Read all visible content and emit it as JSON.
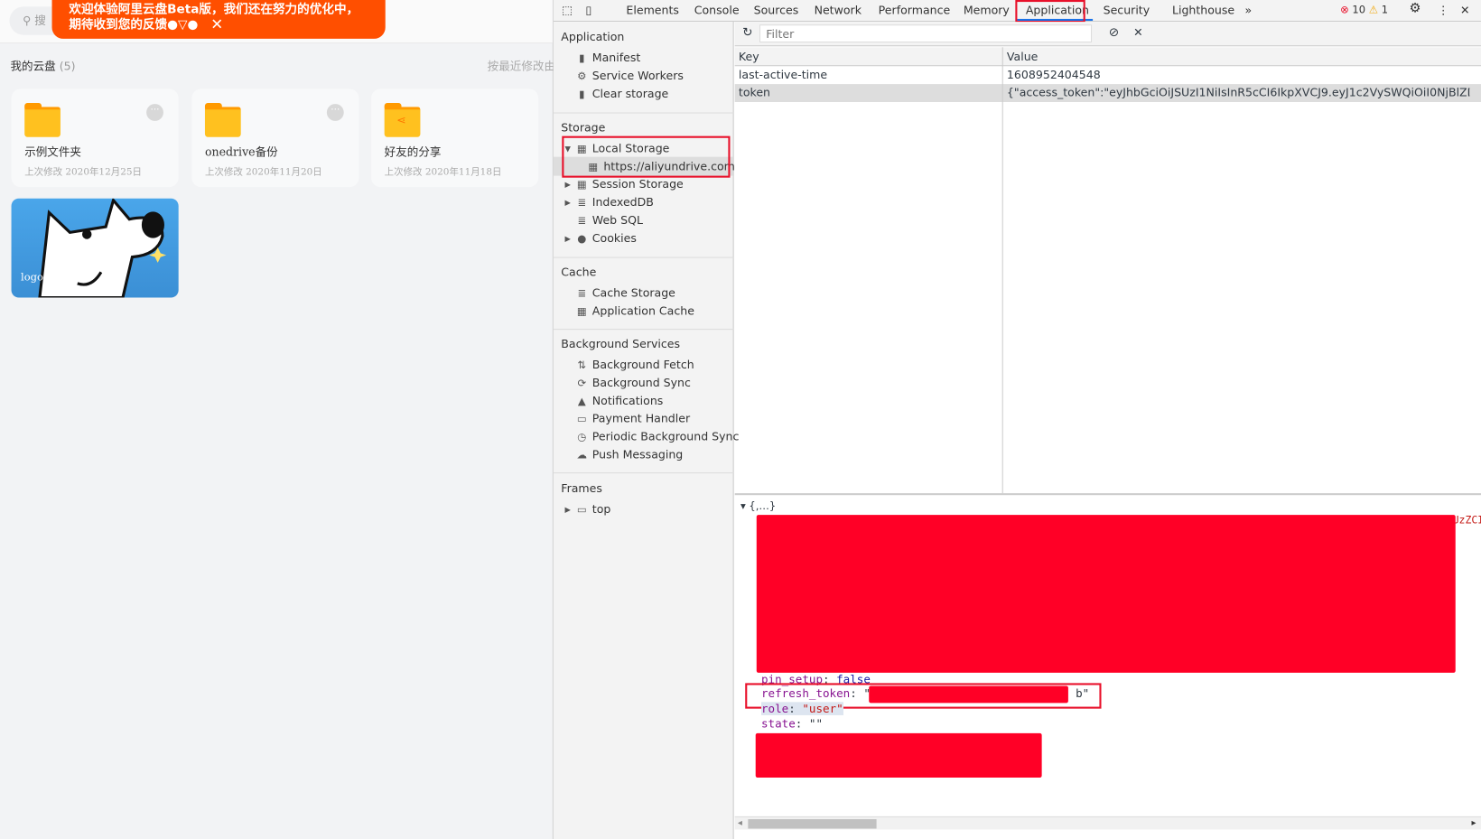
{
  "app": {
    "search_placeholder": "搜",
    "toast": {
      "line1": "欢迎体验阿里云盘Beta版，我们还在努力的优化中，",
      "line2": "期待收到您的反馈●▽●",
      "close": "✕"
    },
    "section_title": "我的云盘",
    "section_count": "(5)",
    "sort_label": "按最近修改由",
    "items": [
      {
        "name": "示例文件夹",
        "date": "上次修改 2020年12月25日",
        "type": "folder"
      },
      {
        "name": "onedrive备份",
        "date": "上次修改 2020年11月20日",
        "type": "folder"
      },
      {
        "name": "好友的分享",
        "date": "上次修改 2020年11月18日",
        "type": "shared-folder"
      },
      {
        "name": "logo.jpg",
        "type": "image"
      }
    ],
    "toast_color": "#ff4f00"
  },
  "devtools": {
    "tabs": [
      "Elements",
      "Console",
      "Sources",
      "Network",
      "Performance",
      "Memory",
      "Application",
      "Security",
      "Lighthouse"
    ],
    "more_tabs": "»",
    "active_tab": "Application",
    "errors": "10",
    "warnings": "1",
    "sidebar": {
      "application": {
        "heading": "Application",
        "items": [
          "Manifest",
          "Service Workers",
          "Clear storage"
        ]
      },
      "storage": {
        "heading": "Storage",
        "items": [
          "Local Storage",
          "https://aliyundrive.com",
          "Session Storage",
          "IndexedDB",
          "Web SQL",
          "Cookies"
        ]
      },
      "cache": {
        "heading": "Cache",
        "items": [
          "Cache Storage",
          "Application Cache"
        ]
      },
      "background": {
        "heading": "Background Services",
        "items": [
          "Background Fetch",
          "Background Sync",
          "Notifications",
          "Payment Handler",
          "Periodic Background Sync",
          "Push Messaging"
        ]
      },
      "frames": {
        "heading": "Frames",
        "items": [
          "top"
        ]
      }
    },
    "filter_placeholder": "Filter",
    "table": {
      "headers": [
        "Key",
        "Value"
      ],
      "rows": [
        {
          "key": "last-active-time",
          "value": "1608952404548"
        },
        {
          "key": "token",
          "value": "{\"access_token\":\"eyJhbGciOiJSUzI1NiIsInR5cCI6IkpXVCJ9.eyJ1c2VySWQiOiI0NjBlZDA0ZW..."
        }
      ]
    },
    "preview": {
      "root": "{,…}",
      "partial": "UzZCI",
      "pin_setup_key": "pin_setup",
      "pin_setup_value": "false",
      "refresh_key": "refresh_token",
      "refresh_start": "\"b",
      "refresh_end": "b\"",
      "role_key": "role",
      "role_value": "\"user\"",
      "state_key": "state",
      "state_value": "\"\""
    },
    "highlight_color": "#e8102a"
  }
}
